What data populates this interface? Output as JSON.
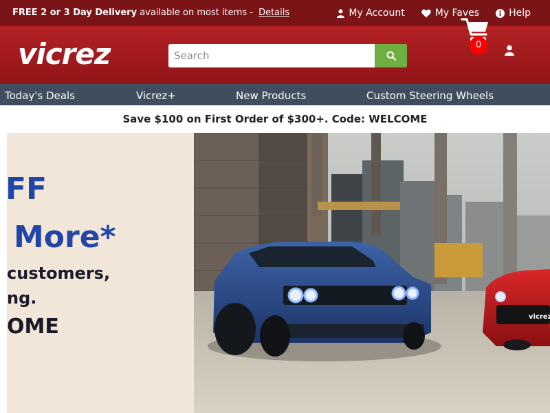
{
  "topbar": {
    "promo_bold": "FREE 2 or 3 Day Delivery",
    "promo_text": " available on most items - ",
    "promo_link": "Details",
    "links": [
      {
        "label": "My Account",
        "icon": "user-icon"
      },
      {
        "label": "My Faves",
        "icon": "heart-icon"
      },
      {
        "label": "Help",
        "icon": "info-icon"
      }
    ]
  },
  "header": {
    "logo": "vicrez",
    "search_placeholder": "Search",
    "search_icon": "search-icon",
    "cart_count": "0",
    "colors": {
      "header": "#a01a1c",
      "topbar": "#7a1416",
      "search_button": "#6fae43",
      "badge": "#ff0000"
    }
  },
  "nav": {
    "items": [
      "Today's Deals",
      "Vicrez+",
      "New Products",
      "Custom Steering Wheels"
    ],
    "color": "#3e4e5e"
  },
  "coupon": {
    "text": "Save $100 on First Order of $300+. Code: WELCOME"
  },
  "hero": {
    "line1": "FF",
    "line2": "More*",
    "line3": "customers,",
    "line4": "ng.",
    "line5": "OME",
    "accent": "#2146a8",
    "background": "#f2e6d9"
  }
}
